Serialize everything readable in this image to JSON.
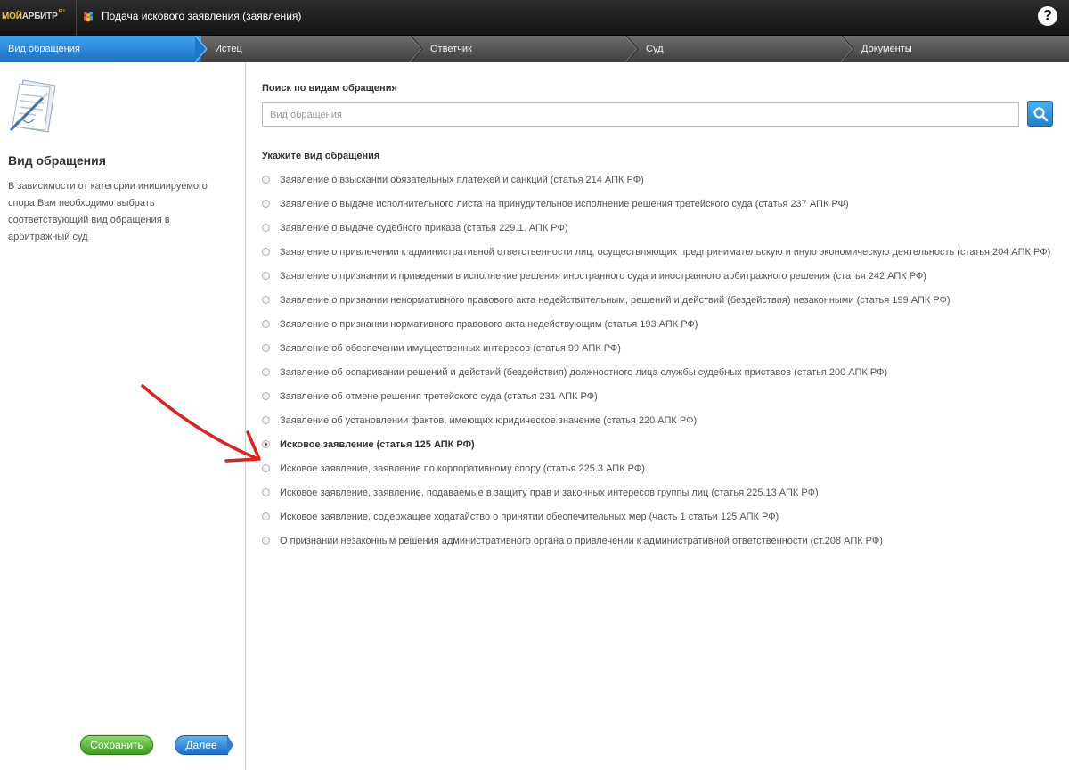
{
  "header": {
    "logo": {
      "part1": "МОЙ",
      "part2": "АРБИТР",
      "suffix": "RU"
    },
    "title": "Подача искового заявления (заявления)",
    "help_symbol": "?"
  },
  "steps": [
    {
      "label": "Вид обращения",
      "active": true
    },
    {
      "label": "Истец",
      "active": false
    },
    {
      "label": "Ответчик",
      "active": false
    },
    {
      "label": "Суд",
      "active": false
    },
    {
      "label": "Документы",
      "active": false
    }
  ],
  "sidebar": {
    "title": "Вид обращения",
    "description": "В зависимости от категории инициируемого спора Вам необходимо выбрать соответствующий вид обращения в арбитражный суд",
    "save_label": "Сохранить",
    "next_label": "Далее"
  },
  "main": {
    "search_label": "Поиск по видам обращения",
    "search_placeholder": "Вид обращения",
    "search_value": "",
    "section_label": "Укажите вид обращения",
    "options": [
      {
        "label": "Заявление о взыскании обязательных платежей и санкций (статья 214 АПК РФ)",
        "selected": false
      },
      {
        "label": "Заявление о выдаче исполнительного листа на принудительное исполнение решения третейского суда (статья 237 АПК РФ)",
        "selected": false
      },
      {
        "label": "Заявление о выдаче судебного приказа (статья 229.1. АПК РФ)",
        "selected": false
      },
      {
        "label": "Заявление о привлечении к административной ответственности лиц, осуществляющих предпринимательскую и иную экономическую деятельность (статья 204 АПК РФ)",
        "selected": false
      },
      {
        "label": "Заявление о признании и приведении в исполнение решения иностранного суда и иностранного арбитражного решения (статья 242 АПК РФ)",
        "selected": false
      },
      {
        "label": "Заявление о признании ненормативного правового акта недействительным, решений и действий (бездействия) незаконными (статья 199 АПК РФ)",
        "selected": false
      },
      {
        "label": "Заявление о признании нормативного правового акта недействующим (статья 193 АПК РФ)",
        "selected": false
      },
      {
        "label": "Заявление об обеспечении имущественных интересов (статья 99 АПК РФ)",
        "selected": false
      },
      {
        "label": "Заявление об оспаривании решений и действий (бездействия) должностного лица службы судебных приставов (статья 200 АПК РФ)",
        "selected": false
      },
      {
        "label": "Заявление об отмене решения третейского суда (статья 231 АПК РФ)",
        "selected": false
      },
      {
        "label": "Заявление об установлении фактов, имеющих юридическое значение (статья 220 АПК РФ)",
        "selected": false
      },
      {
        "label": "Исковое заявление (статья 125 АПК РФ)",
        "selected": true
      },
      {
        "label": "Исковое заявление, заявление по корпоративному спору (статья 225.3 АПК РФ)",
        "selected": false
      },
      {
        "label": "Исковое заявление, заявление, подаваемые в защиту прав и законных интересов группы лиц (статья 225.13 АПК РФ)",
        "selected": false
      },
      {
        "label": "Исковое заявление, содержащее ходатайство о принятии обеспечительных мер (часть 1 статьи 125 АПК РФ)",
        "selected": false
      },
      {
        "label": "О признании незаконным решения административного органа о привлечении к административной ответственности (ст.208 АПК РФ)",
        "selected": false
      }
    ]
  },
  "icons": {
    "app": "people-icon",
    "document": "signed-document-icon",
    "search": "search-icon",
    "annotation": "red-arrow-icon"
  },
  "colors": {
    "topbar": "#1e1e1e",
    "active_step": "#2a86d6",
    "save_button": "#5bb53a",
    "next_button": "#2a80d0",
    "annotation_arrow": "#e02020"
  }
}
